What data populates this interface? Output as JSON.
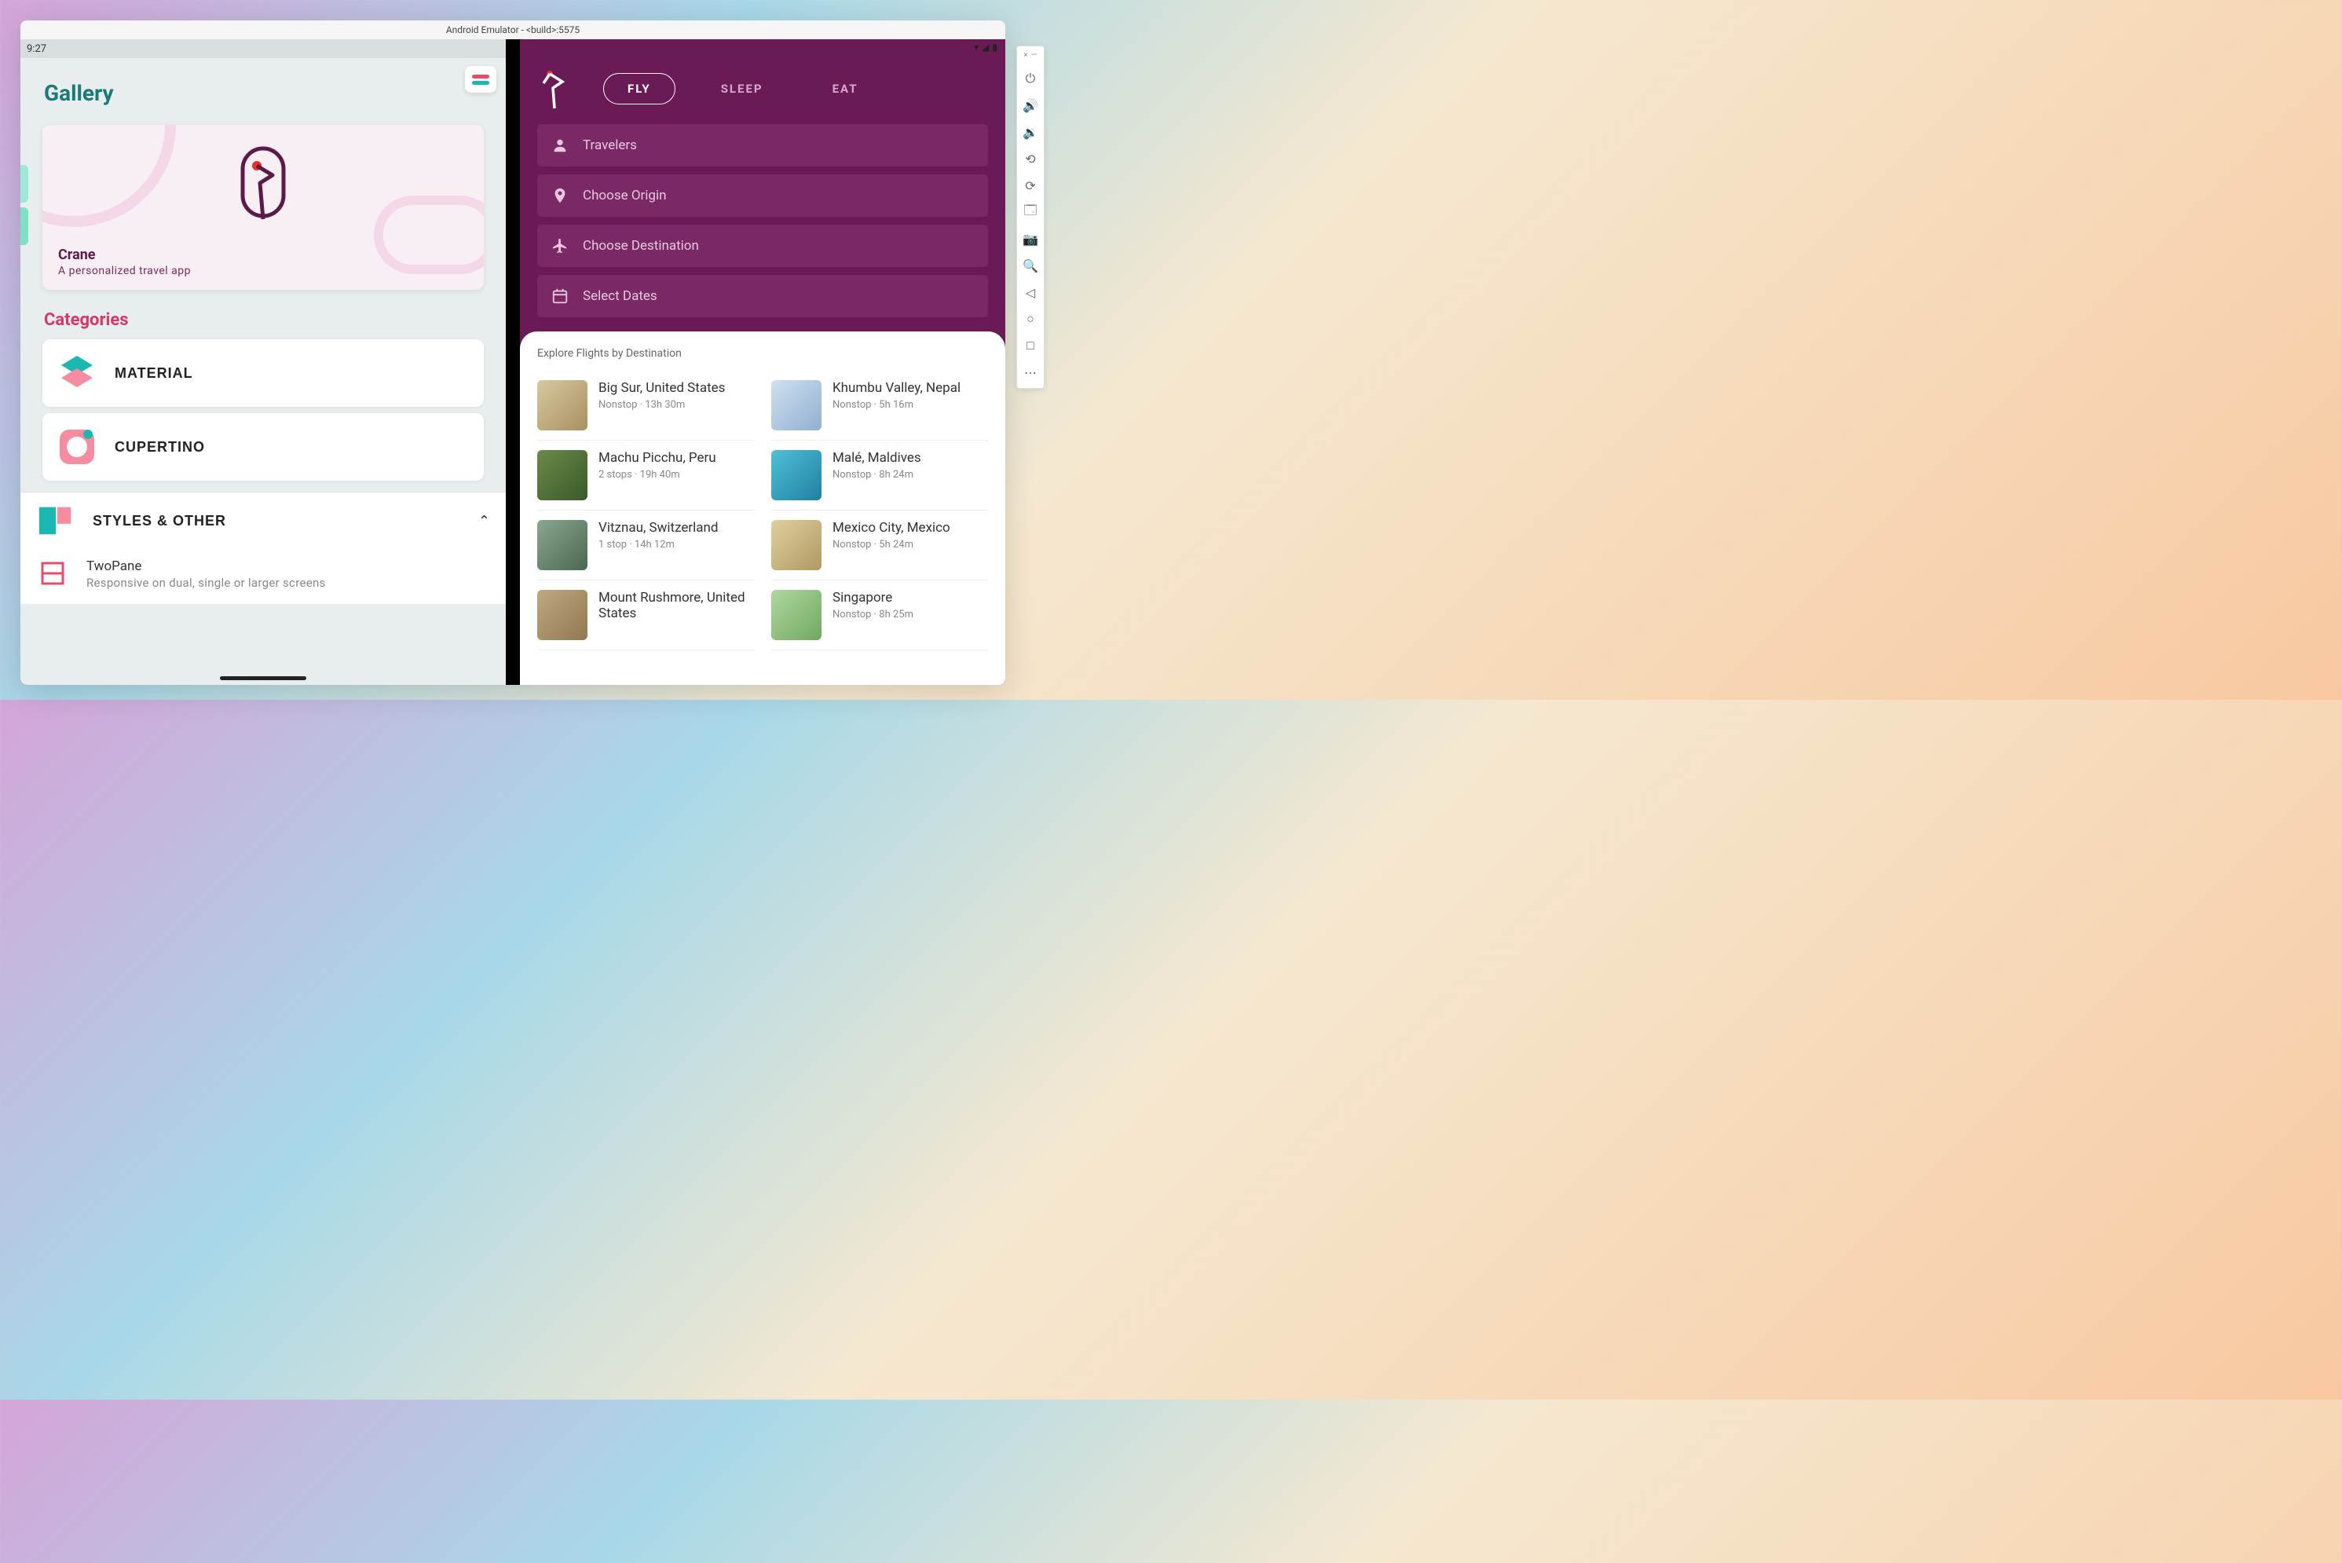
{
  "window": {
    "title": "Android Emulator - <build>:5575"
  },
  "status": {
    "time": "9:27"
  },
  "gallery": {
    "title": "Gallery",
    "crane": {
      "name": "Crane",
      "subtitle": "A personalized travel app"
    },
    "categories_title": "Categories",
    "categories": [
      {
        "label": "MATERIAL"
      },
      {
        "label": "CUPERTINO"
      }
    ],
    "styles": {
      "label": "STYLES & OTHER",
      "items": [
        {
          "title": "TwoPane",
          "subtitle": "Responsive on dual, single or larger screens"
        }
      ]
    }
  },
  "crane_app": {
    "tabs": {
      "fly": "FLY",
      "sleep": "SLEEP",
      "eat": "EAT"
    },
    "fields": {
      "travelers": "Travelers",
      "origin": "Choose Origin",
      "destination": "Choose Destination",
      "dates": "Select Dates"
    },
    "explore_title": "Explore Flights by Destination",
    "destinations_left": [
      {
        "name": "Big Sur, United States",
        "meta": "Nonstop · 13h 30m",
        "bg": "linear-gradient(135deg,#d8c8a0,#a89060)"
      },
      {
        "name": "Machu Picchu, Peru",
        "meta": "2 stops · 19h 40m",
        "bg": "linear-gradient(135deg,#6a8a4a,#3a5a2a)"
      },
      {
        "name": "Vitznau, Switzerland",
        "meta": "1 stop · 14h 12m",
        "bg": "linear-gradient(135deg,#8aa890,#4a6850)"
      },
      {
        "name": "Mount Rushmore, United States",
        "meta": "",
        "bg": "linear-gradient(135deg,#c0a880,#907850)"
      }
    ],
    "destinations_right": [
      {
        "name": "Khumbu Valley, Nepal",
        "meta": "Nonstop · 5h 16m",
        "bg": "linear-gradient(135deg,#d0e0f0,#90b0d0)"
      },
      {
        "name": "Malé, Maldives",
        "meta": "Nonstop · 8h 24m",
        "bg": "linear-gradient(135deg,#50c0d8,#2080a0)"
      },
      {
        "name": "Mexico City, Mexico",
        "meta": "Nonstop · 5h 24m",
        "bg": "linear-gradient(135deg,#e0d0a0,#b09860)"
      },
      {
        "name": "Singapore",
        "meta": "Nonstop · 8h 25m",
        "bg": "linear-gradient(135deg,#b0d8a0,#70a860)"
      }
    ]
  }
}
